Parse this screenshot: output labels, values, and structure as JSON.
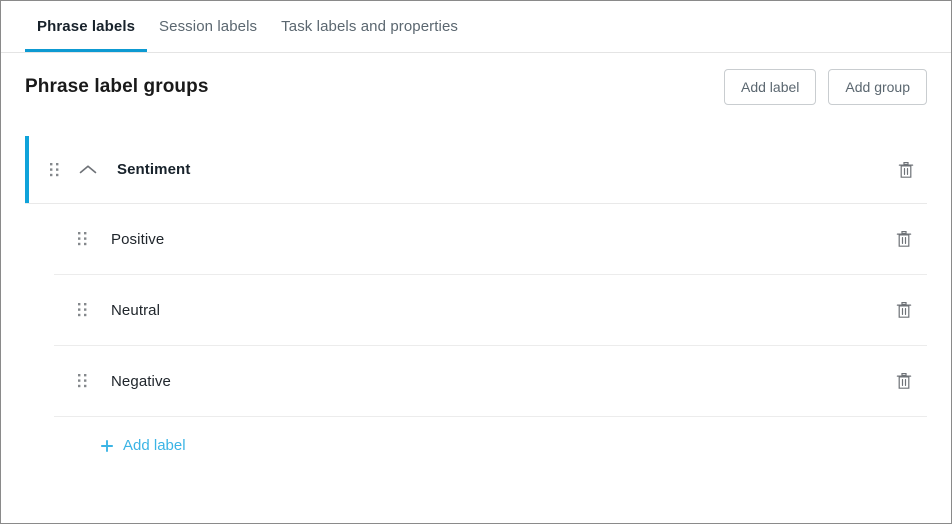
{
  "tabs": [
    {
      "label": "Phrase labels",
      "active": true
    },
    {
      "label": "Session labels",
      "active": false
    },
    {
      "label": "Task labels and properties",
      "active": false
    }
  ],
  "header": {
    "title": "Phrase label groups",
    "add_label_button": "Add label",
    "add_group_button": "Add group"
  },
  "group": {
    "name": "Sentiment",
    "drag_handle_icon": "drag-handle-icon",
    "collapse_icon": "chevron-up-icon",
    "delete_icon": "trash-icon",
    "labels": [
      {
        "name": "Positive"
      },
      {
        "name": "Neutral"
      },
      {
        "name": "Negative"
      }
    ],
    "add_label_link": "Add label",
    "add_label_icon": "plus-icon"
  },
  "colors": {
    "accent": "#0fa3da",
    "tab_underline": "#0d9ad2",
    "link": "#3bb4e5",
    "text": "#18222b",
    "muted_text": "#5b6770",
    "border": "#e9e9e9",
    "icon": "#6e7277"
  }
}
